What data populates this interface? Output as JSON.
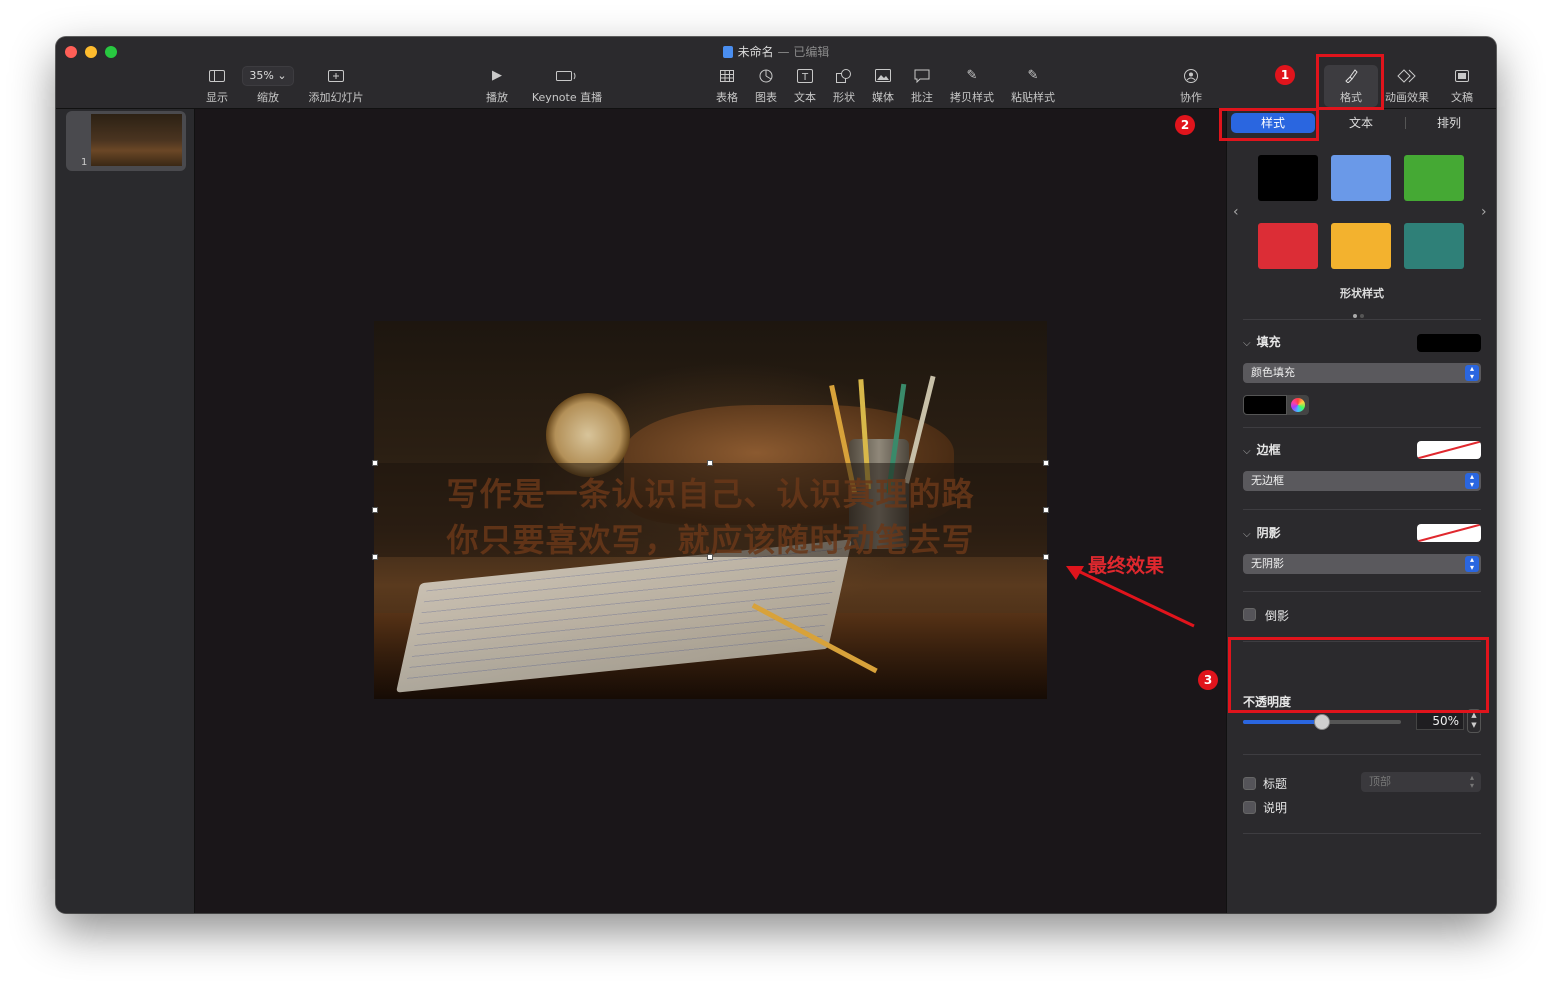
{
  "window": {
    "doc_title": "未命名",
    "separator": "—",
    "status": "已编辑"
  },
  "toolbar": {
    "view_label": "显示",
    "zoom_value": "35%",
    "zoom_label": "缩放",
    "add_slide_label": "添加幻灯片",
    "play_label": "播放",
    "keynote_live_label": "Keynote 直播",
    "table_label": "表格",
    "chart_label": "图表",
    "text_label": "文本",
    "shape_label": "形状",
    "media_label": "媒体",
    "comment_label": "批注",
    "copy_style_label": "拷贝样式",
    "paste_style_label": "粘贴样式",
    "collaborate_label": "协作",
    "format_label": "格式",
    "animate_label": "动画效果",
    "document_label": "文稿"
  },
  "sidebar": {
    "slides": [
      {
        "number": "1"
      }
    ]
  },
  "slide": {
    "line1": "写作是一条认识自己、认识真理的路",
    "line2": "你只要喜欢写，就应该随时动笔去写"
  },
  "annotation": {
    "final_effect": "最终效果",
    "badge1": "1",
    "badge2": "2",
    "badge3": "3"
  },
  "inspector": {
    "tabs": [
      "样式",
      "文本",
      "排列"
    ],
    "swatches": [
      "#000000",
      "#6a99e8",
      "#45a934",
      "#dc2d36",
      "#f3b22e",
      "#2f8078"
    ],
    "shape_styles_label": "形状样式",
    "fill": {
      "title": "填充",
      "color": "#000000",
      "type": "颜色填充"
    },
    "border": {
      "title": "边框",
      "type": "无边框"
    },
    "shadow": {
      "title": "阴影",
      "type": "无阴影"
    },
    "reflection_label": "倒影",
    "opacity": {
      "title": "不透明度",
      "value": 0.5,
      "value_text": "50%"
    },
    "caption_title_label": "标题",
    "caption_position": "顶部",
    "description_label": "说明"
  },
  "accent_color": "#2a66e0",
  "annotation_color": "#e0141c"
}
